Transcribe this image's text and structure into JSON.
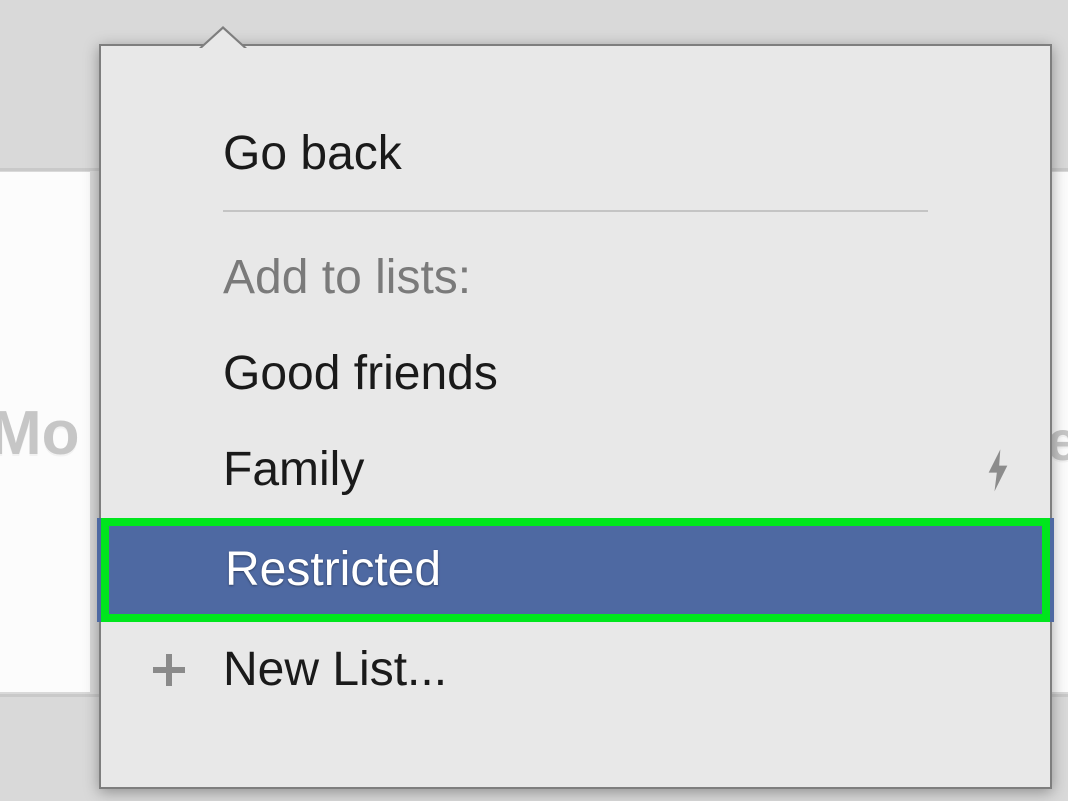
{
  "background": {
    "left_fragment": "Mo",
    "right_fragment": "e"
  },
  "menu": {
    "go_back": "Go back",
    "section_header": "Add to lists:",
    "items": {
      "good_friends": "Good friends",
      "family": "Family",
      "restricted": "Restricted",
      "new_list": "New List..."
    }
  }
}
